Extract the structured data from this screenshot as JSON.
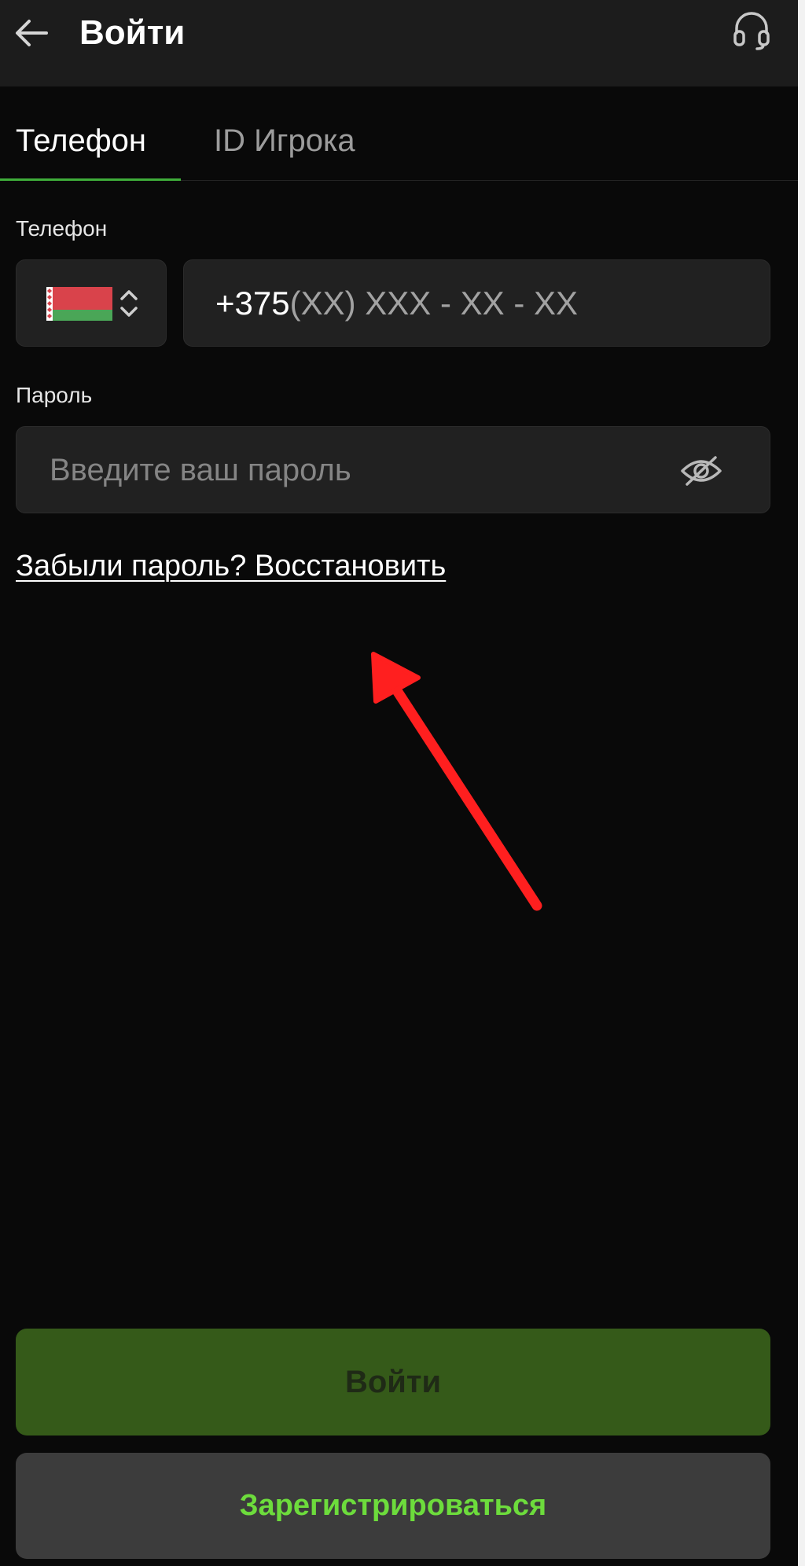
{
  "header": {
    "title": "Войти",
    "back_icon": "arrow-left-icon",
    "support_icon": "headset-icon"
  },
  "tabs": [
    {
      "label": "Телефон",
      "active": true
    },
    {
      "label": "ID Игрока",
      "active": false
    }
  ],
  "phone": {
    "label": "Телефон",
    "country_flag": "belarus-flag-icon",
    "prefix": "+375",
    "mask": "(XX) XXX - XX - XX"
  },
  "password": {
    "label": "Пароль",
    "placeholder": "Введите ваш пароль",
    "visibility_icon": "eye-off-icon"
  },
  "forgot_link": "Забыли пароль? Восстановить",
  "buttons": {
    "login": "Войти",
    "register": "Зарегистрироваться"
  },
  "colors": {
    "accent": "#3fae3a",
    "login_button_bg": "#355a19",
    "register_text": "#6ddc3c",
    "annotation_arrow": "#ff1f1f"
  }
}
